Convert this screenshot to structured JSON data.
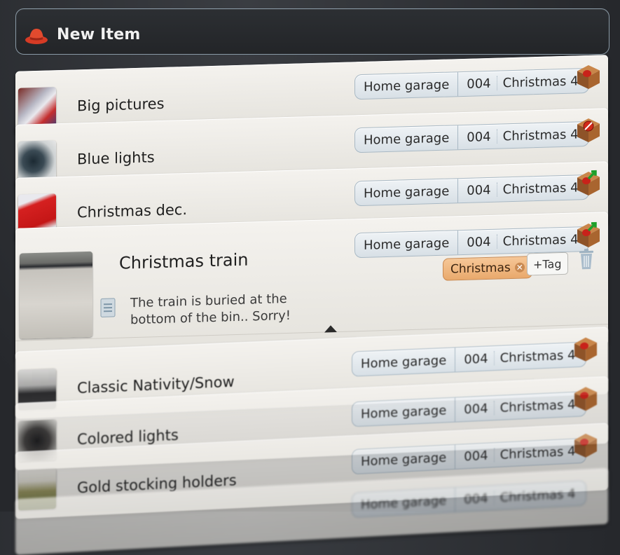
{
  "new_item": {
    "label": "New Item",
    "icon": "red-hat-icon"
  },
  "rows": [
    {
      "name": "Big pictures",
      "place": "Home garage",
      "bin": "004",
      "container": "Christmas 4",
      "status_icon": "box-icon"
    },
    {
      "name": "Blue lights",
      "place": "Home garage",
      "bin": "004",
      "container": "Christmas 4",
      "status_icon": "box-forbidden-icon"
    },
    {
      "name": "Christmas dec.",
      "place": "Home garage",
      "bin": "004",
      "container": "Christmas 4",
      "status_icon": "box-checkout-icon"
    },
    {
      "name": "Christmas train",
      "place": "Home garage",
      "bin": "004",
      "container": "Christmas 4",
      "status_icon": "box-checkout-icon",
      "note": "The train is buried at the bottom of the bin.. Sorry!",
      "tags": [
        "Christmas"
      ],
      "add_tag_label": "+Tag"
    },
    {
      "name": "Classic Nativity/Snow",
      "place": "Home garage",
      "bin": "004",
      "container": "Christmas 4",
      "status_icon": "box-icon"
    },
    {
      "name": "Colored lights",
      "place": "Home garage",
      "bin": "004",
      "container": "Christmas 4",
      "status_icon": "box-icon"
    },
    {
      "name": "Gold stocking holders",
      "place": "Home garage",
      "bin": "004",
      "container": "Christmas 4",
      "status_icon": "box-icon"
    },
    {
      "name": "",
      "place": "Home garage",
      "bin": "004",
      "container": "Christmas 4",
      "status_icon": "box-icon"
    }
  ],
  "colors": {
    "tag_bg": "#e9a96c",
    "location_bg": "#d8e0e6",
    "row_bg": "#eeece7",
    "background": "#2b2d31"
  }
}
